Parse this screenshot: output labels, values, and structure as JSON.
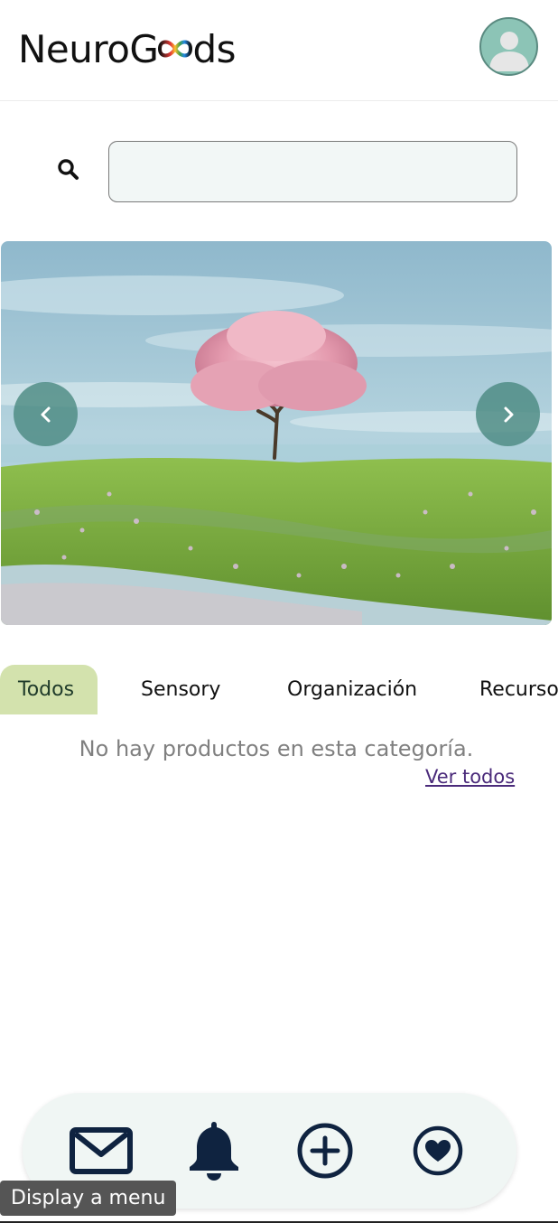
{
  "header": {
    "logo_prefix": "NeuroG",
    "logo_suffix": "ds",
    "logo_full": "NeuroGoods"
  },
  "search": {
    "value": "",
    "placeholder": ""
  },
  "carousel": {
    "prev_label": "‹",
    "next_label": "›"
  },
  "tabs": [
    {
      "label": "Todos",
      "active": true
    },
    {
      "label": "Sensory",
      "active": false
    },
    {
      "label": "Organización",
      "active": false
    },
    {
      "label": "Recursos",
      "active": false
    }
  ],
  "products": {
    "empty_message": "No hay productos en esta categoría.",
    "see_all": "Ver todos"
  },
  "bottom_nav": {
    "icons": [
      "mail-icon",
      "bell-icon",
      "add-circle-icon",
      "heart-circle-icon"
    ]
  },
  "tooltip": {
    "text": "Display a menu"
  },
  "colors": {
    "accent_tab": "#d3e2ad",
    "nav_icon": "#0f2340",
    "carousel_button": "#46877d",
    "avatar_bg": "#8cc4b6",
    "link": "#4a2a7a"
  }
}
